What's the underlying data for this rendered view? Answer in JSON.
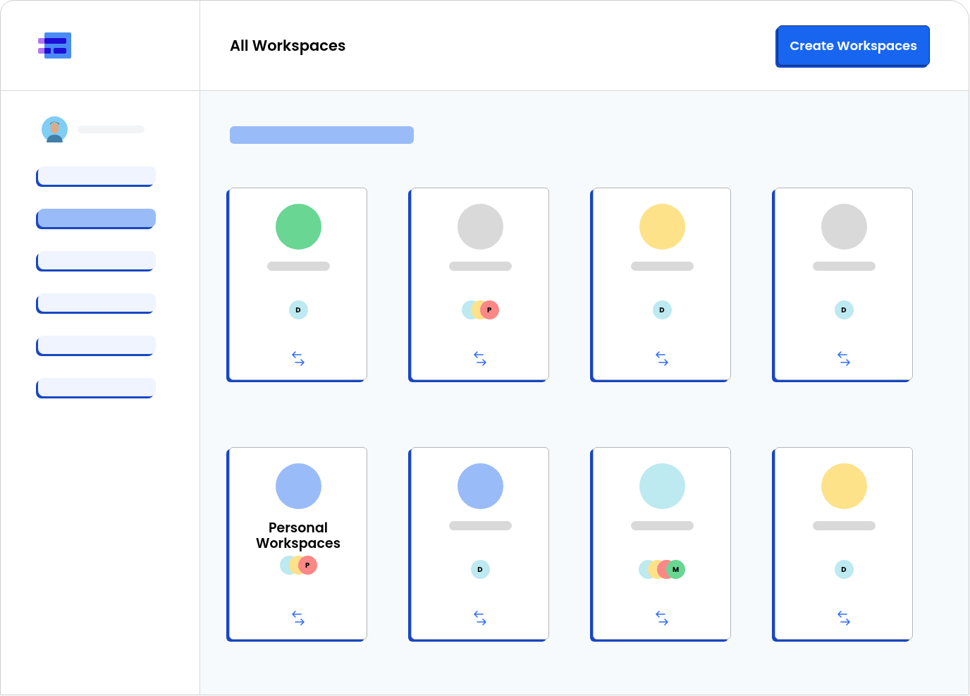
{
  "header": {
    "title": "All Workspaces",
    "create_button": "Create Workspaces"
  },
  "sidebar": {
    "items": [
      {
        "selected": false
      },
      {
        "selected": true
      },
      {
        "selected": false
      },
      {
        "selected": false
      },
      {
        "selected": false
      },
      {
        "selected": false
      }
    ]
  },
  "workspaces": [
    {
      "color": "#69d694",
      "kind": "placeholder",
      "members": [
        {
          "initial": "D",
          "color": "#bde9f0"
        }
      ]
    },
    {
      "color": "#d9d9d9",
      "kind": "placeholder",
      "members": [
        {
          "color": "#bde9f0"
        },
        {
          "color": "#fde28a"
        },
        {
          "initial": "P",
          "color": "#fb8886"
        }
      ]
    },
    {
      "color": "#fde28a",
      "kind": "placeholder",
      "members": [
        {
          "initial": "D",
          "color": "#bde9f0"
        }
      ]
    },
    {
      "color": "#d9d9d9",
      "kind": "placeholder",
      "members": [
        {
          "initial": "D",
          "color": "#bde9f0"
        }
      ]
    },
    {
      "color": "#99bbf8",
      "kind": "titled",
      "name": "Personal Workspaces",
      "members": [
        {
          "color": "#bde9f0"
        },
        {
          "color": "#fde28a"
        },
        {
          "initial": "P",
          "color": "#fb8886"
        }
      ]
    },
    {
      "color": "#99bbf8",
      "kind": "placeholder",
      "members": [
        {
          "initial": "D",
          "color": "#bde9f0"
        }
      ]
    },
    {
      "color": "#bde9f0",
      "kind": "placeholder",
      "members": [
        {
          "color": "#bde9f0"
        },
        {
          "color": "#fde28a"
        },
        {
          "color": "#fb8886"
        },
        {
          "initial": "M",
          "color": "#69d694"
        }
      ]
    },
    {
      "color": "#fde28a",
      "kind": "placeholder",
      "members": [
        {
          "initial": "D",
          "color": "#bde9f0"
        }
      ]
    }
  ]
}
